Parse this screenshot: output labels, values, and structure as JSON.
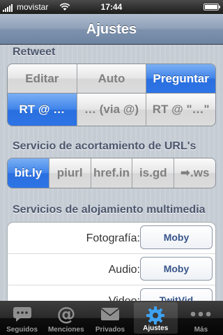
{
  "status_bar": {
    "carrier": "movistar",
    "time": "17:44",
    "battery_level": 1.0
  },
  "nav": {
    "title": "Ajustes"
  },
  "retweet": {
    "header": "Retweet",
    "mode_options": [
      "Editar",
      "Auto",
      "Preguntar"
    ],
    "mode_selected": "Preguntar",
    "format_options": [
      "RT @ …",
      "… (via @)",
      "RT @ \"…\""
    ],
    "format_selected": "RT @ …"
  },
  "shortener": {
    "header": "Servicio de acortamiento de URL's",
    "options": [
      "bit.ly",
      "piurl",
      "href.in",
      "is.gd",
      "➡.ws"
    ],
    "selected": "bit.ly"
  },
  "hosting": {
    "header": "Servicios de alojamiento multimedia",
    "rows": [
      {
        "label": "Fotografía:",
        "value": "Moby"
      },
      {
        "label": "Audio:",
        "value": "Moby"
      },
      {
        "label": "Video:",
        "value": "TwitVid"
      }
    ]
  },
  "tabs": [
    {
      "label": "Seguidos",
      "icon": "speech-bubble-icon"
    },
    {
      "label": "Menciones",
      "icon": "at-sign-icon"
    },
    {
      "label": "Privados",
      "icon": "envelope-icon"
    },
    {
      "label": "Ajustes",
      "icon": "gear-icon",
      "active": true
    },
    {
      "label": "Más",
      "icon": "more-dots-icon"
    }
  ]
}
